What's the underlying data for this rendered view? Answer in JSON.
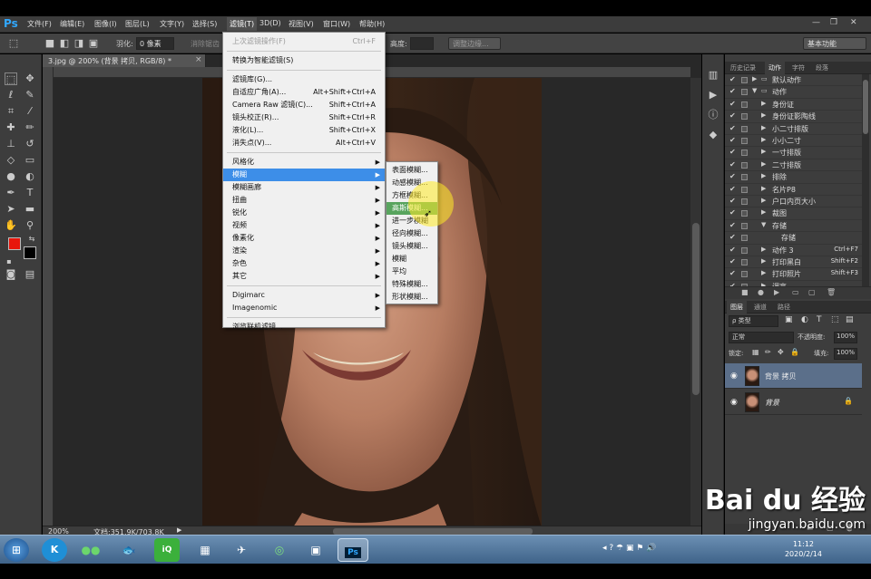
{
  "menubar": {
    "logo": "Ps",
    "items": [
      "文件(F)",
      "编辑(E)",
      "图像(I)",
      "图层(L)",
      "文字(Y)",
      "选择(S)",
      "滤镜(T)",
      "3D(D)",
      "视图(V)",
      "窗口(W)",
      "帮助(H)"
    ],
    "active_index": 6
  },
  "window_controls": {
    "minimize": "—",
    "restore": "❐",
    "close": "✕"
  },
  "options": {
    "feather_label": "羽化:",
    "feather_value": "0 像素",
    "antialias_label": "消除锯齿",
    "height_label": "高度:",
    "refine_edge": "调整边缘...",
    "workspace": "基本功能"
  },
  "document": {
    "tab_title": "3.jpg @ 200% (背景 拷贝, RGB/8) *",
    "zoom": "200%",
    "doc_info": "文档:351.9K/703.8K"
  },
  "filter_menu": {
    "items": [
      {
        "label": "上次滤镜操作(F)",
        "shortcut": "Ctrl+F",
        "disabled": true
      },
      {
        "sep": true
      },
      {
        "label": "转换为智能滤镜(S)",
        "shortcut": ""
      },
      {
        "sep": true
      },
      {
        "label": "滤镜库(G)...",
        "shortcut": ""
      },
      {
        "label": "自适应广角(A)...",
        "shortcut": "Alt+Shift+Ctrl+A"
      },
      {
        "label": "Camera Raw 滤镜(C)...",
        "shortcut": "Shift+Ctrl+A"
      },
      {
        "label": "镜头校正(R)...",
        "shortcut": "Shift+Ctrl+R"
      },
      {
        "label": "液化(L)...",
        "shortcut": "Shift+Ctrl+X"
      },
      {
        "label": "消失点(V)...",
        "shortcut": "Alt+Ctrl+V"
      },
      {
        "sep": true
      },
      {
        "label": "风格化",
        "submenu": true
      },
      {
        "label": "模糊",
        "submenu": true,
        "highlight": true
      },
      {
        "label": "模糊画廊",
        "submenu": true
      },
      {
        "label": "扭曲",
        "submenu": true
      },
      {
        "label": "锐化",
        "submenu": true
      },
      {
        "label": "视频",
        "submenu": true
      },
      {
        "label": "像素化",
        "submenu": true
      },
      {
        "label": "渲染",
        "submenu": true
      },
      {
        "label": "杂色",
        "submenu": true
      },
      {
        "label": "其它",
        "submenu": true
      },
      {
        "sep": true
      },
      {
        "label": "Digimarc",
        "submenu": true
      },
      {
        "label": "Imagenomic",
        "submenu": true
      },
      {
        "sep": true
      },
      {
        "label": "浏览联机滤镜...",
        "shortcut": ""
      }
    ]
  },
  "blur_submenu": {
    "items": [
      {
        "label": "表面模糊..."
      },
      {
        "label": "动感模糊..."
      },
      {
        "label": "方框模糊..."
      },
      {
        "label": "高斯模糊...",
        "highlight": true
      },
      {
        "label": "进一步模糊"
      },
      {
        "label": "径向模糊..."
      },
      {
        "label": "镜头模糊..."
      },
      {
        "label": "模糊"
      },
      {
        "label": "平均"
      },
      {
        "label": "特殊模糊..."
      },
      {
        "label": "形状模糊..."
      }
    ]
  },
  "actions_panel": {
    "tabs": [
      "历史记录",
      "动作",
      "字符",
      "段落"
    ],
    "active_tab": 1,
    "rows": [
      {
        "indent": 0,
        "name": "默认动作",
        "folder": true,
        "expanded": false,
        "shortcut": ""
      },
      {
        "indent": 0,
        "name": "动作",
        "folder": true,
        "expanded": true,
        "shortcut": ""
      },
      {
        "indent": 1,
        "name": "身份证",
        "shortcut": ""
      },
      {
        "indent": 1,
        "name": "身份证影陶线",
        "shortcut": ""
      },
      {
        "indent": 1,
        "name": "小二寸排版",
        "shortcut": ""
      },
      {
        "indent": 1,
        "name": "小小二寸",
        "shortcut": ""
      },
      {
        "indent": 1,
        "name": "一寸排版",
        "shortcut": ""
      },
      {
        "indent": 1,
        "name": "二寸排版",
        "shortcut": ""
      },
      {
        "indent": 1,
        "name": "排除",
        "shortcut": ""
      },
      {
        "indent": 1,
        "name": "名片P8",
        "shortcut": ""
      },
      {
        "indent": 1,
        "name": "户口内页大小",
        "shortcut": ""
      },
      {
        "indent": 1,
        "name": "裁图",
        "shortcut": ""
      },
      {
        "indent": 1,
        "name": "存储",
        "shortcut": "",
        "expanded": true
      },
      {
        "indent": 2,
        "name": "存储",
        "shortcut": ""
      },
      {
        "indent": 1,
        "name": "动作 3",
        "shortcut": "Ctrl+F7"
      },
      {
        "indent": 1,
        "name": "打印黑白",
        "shortcut": "Shift+F2"
      },
      {
        "indent": 1,
        "name": "打印照片",
        "shortcut": "Shift+F3"
      },
      {
        "indent": 1,
        "name": "调亮",
        "shortcut": ""
      }
    ]
  },
  "layers_panel": {
    "tabs": [
      "图层",
      "通道",
      "路径"
    ],
    "kind_filter": "ρ 类型",
    "blend_mode": "正常",
    "opacity_label": "不透明度:",
    "opacity_value": "100%",
    "lock_label": "锁定:",
    "fill_label": "填充:",
    "fill_value": "100%",
    "layers": [
      {
        "name": "背景 拷贝",
        "selected": true,
        "locked": false
      },
      {
        "name": "背景",
        "selected": false,
        "locked": true
      }
    ]
  },
  "taskbar": {
    "clock_time": "11:12",
    "clock_date": "2020/2/14",
    "apps": [
      "start",
      "kuaiya",
      "wechat",
      "fish",
      "iqiyi",
      "calc",
      "bird",
      "browser",
      "viewer",
      "photoshop"
    ]
  },
  "watermark": {
    "brand": "Bai du 经验",
    "url": "jingyan.baidu.com"
  },
  "colors": {
    "foreground": "#e8160c",
    "background": "#000000",
    "menu_highlight": "#3d8ee8",
    "sub_highlight": "#58a45e",
    "accent": "#31a8ff"
  }
}
